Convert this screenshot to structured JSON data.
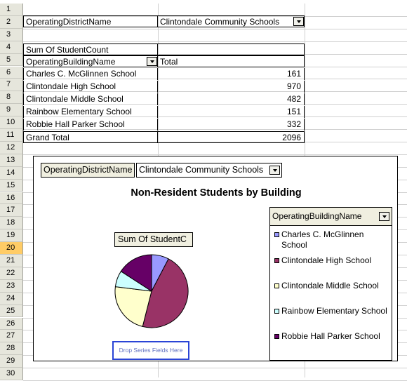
{
  "sheet": {
    "rows": [
      "1",
      "2",
      "3",
      "4",
      "5",
      "6",
      "7",
      "8",
      "9",
      "10",
      "11",
      "12",
      "13",
      "14",
      "15",
      "16",
      "17",
      "18",
      "19",
      "20",
      "21",
      "22",
      "23",
      "24",
      "25",
      "26",
      "27",
      "28",
      "29",
      "30"
    ],
    "selected_row": "20",
    "page_field_label": "OperatingDistrictName",
    "page_field_value": "Clintondale Community Schools",
    "data_field": "Sum Of StudentCount",
    "row_field": "OperatingBuildingName",
    "total_header": "Total",
    "table": [
      {
        "name": "Charles C. McGlinnen School",
        "value": "161"
      },
      {
        "name": "Clintondale High School",
        "value": "970"
      },
      {
        "name": "Clintondale Middle School",
        "value": "482"
      },
      {
        "name": "Rainbow Elementary School",
        "value": "151"
      },
      {
        "name": "Robbie Hall Parker School",
        "value": "332"
      }
    ],
    "grand_total_label": "Grand Total",
    "grand_total_value": "2096"
  },
  "chart": {
    "page_field_label": "OperatingDistrictName",
    "page_field_value": "Clintondale Community Schools",
    "title": "Non-Resident Students by Building",
    "data_field_button": "Sum Of StudentC",
    "drop_zone_text": "Drop Series Fields Here",
    "legend_header": "OperatingBuildingName",
    "legend_items": [
      {
        "label": "Charles C. McGlinnen School",
        "color": "#9999ff"
      },
      {
        "label": "Clintondale High School",
        "color": "#993366"
      },
      {
        "label": "Clintondale Middle School",
        "color": "#ffffcc"
      },
      {
        "label": "Rainbow Elementary School",
        "color": "#ccffff"
      },
      {
        "label": "Robbie Hall Parker School",
        "color": "#660066"
      }
    ]
  },
  "chart_data": {
    "type": "pie",
    "title": "Non-Resident Students by Building",
    "categories": [
      "Charles C. McGlinnen School",
      "Clintondale High School",
      "Clintondale Middle School",
      "Rainbow Elementary School",
      "Robbie Hall Parker School"
    ],
    "values": [
      161,
      970,
      482,
      151,
      332
    ],
    "colors": [
      "#9999ff",
      "#993366",
      "#ffffcc",
      "#ccffff",
      "#660066"
    ],
    "legend": "right"
  }
}
